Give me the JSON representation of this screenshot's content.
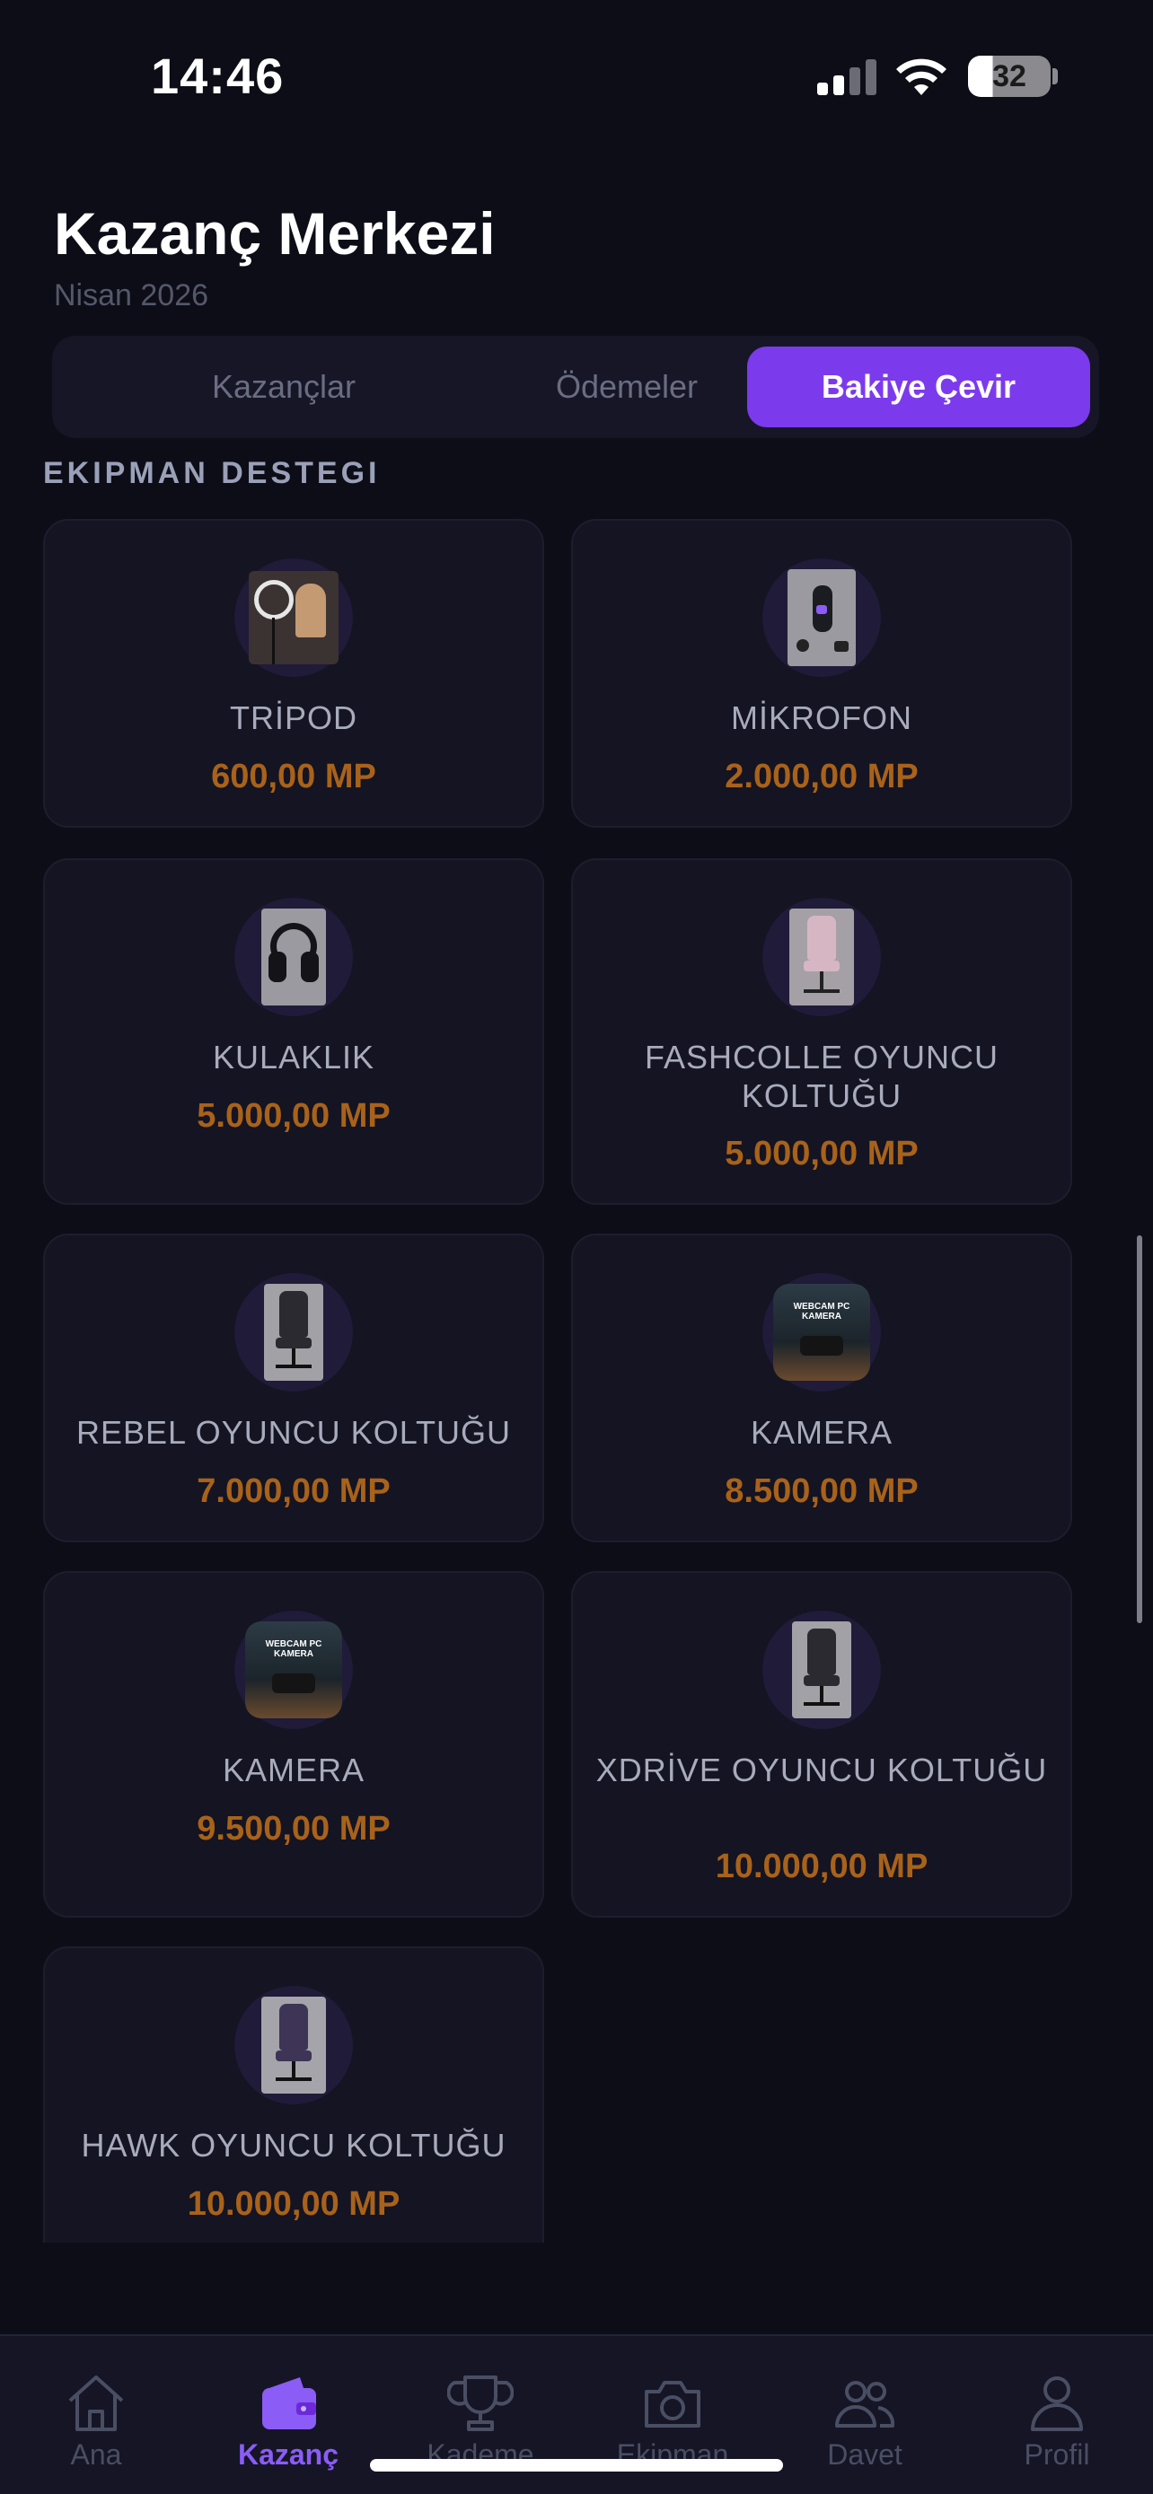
{
  "status_bar": {
    "time": "14:46",
    "battery": "32"
  },
  "header": {
    "title": "Kazanç Merkezi",
    "subtitle": "Nisan 2026"
  },
  "tabs": [
    {
      "label": "Kazançlar",
      "active": false
    },
    {
      "label": "Ödemeler",
      "active": false
    },
    {
      "label": "Bakiye Çevir",
      "active": true
    }
  ],
  "section": {
    "title": "EKIPMAN DESTEGI"
  },
  "items": [
    {
      "name": "TRİPOD",
      "price": "600,00 MP",
      "icon": "tripod-ring-light-image"
    },
    {
      "name": "MİKROFON",
      "price": "2.000,00 MP",
      "icon": "microphone-image"
    },
    {
      "name": "KULAKLIK",
      "price": "5.000,00 MP",
      "icon": "headphones-image"
    },
    {
      "name": "FASHCOLLE OYUNCU KOLTUĞU",
      "price": "5.000,00 MP",
      "icon": "gaming-chair-image"
    },
    {
      "name": "REBEL OYUNCU KOLTUĞU",
      "price": "7.000,00 MP",
      "icon": "gaming-chair-image"
    },
    {
      "name": "KAMERA",
      "price": "8.500,00 MP",
      "icon": "webcam-image",
      "thumb_text": "WEBCAM PC KAMERA"
    },
    {
      "name": "KAMERA",
      "price": "9.500,00 MP",
      "icon": "webcam-image",
      "thumb_text": "WEBCAM PC KAMERA"
    },
    {
      "name": "XDRİVE OYUNCU KOLTUĞU",
      "price": "10.000,00 MP",
      "icon": "gaming-chair-image"
    },
    {
      "name": "HAWK OYUNCU KOLTUĞU",
      "price": "10.000,00 MP",
      "icon": "gaming-chair-image"
    }
  ],
  "bottom_nav": [
    {
      "label": "Ana",
      "icon": "home-icon",
      "active": false
    },
    {
      "label": "Kazanç",
      "icon": "wallet-icon",
      "active": true
    },
    {
      "label": "Kademe",
      "icon": "trophy-icon",
      "active": false
    },
    {
      "label": "Ekipman",
      "icon": "camera-icon",
      "active": false
    },
    {
      "label": "Davet",
      "icon": "users-icon",
      "active": false
    },
    {
      "label": "Profil",
      "icon": "user-icon",
      "active": false
    }
  ],
  "colors": {
    "accent": "#7c3aed",
    "price": "#a8621a",
    "background": "#0d0d17",
    "card": "#141422"
  }
}
